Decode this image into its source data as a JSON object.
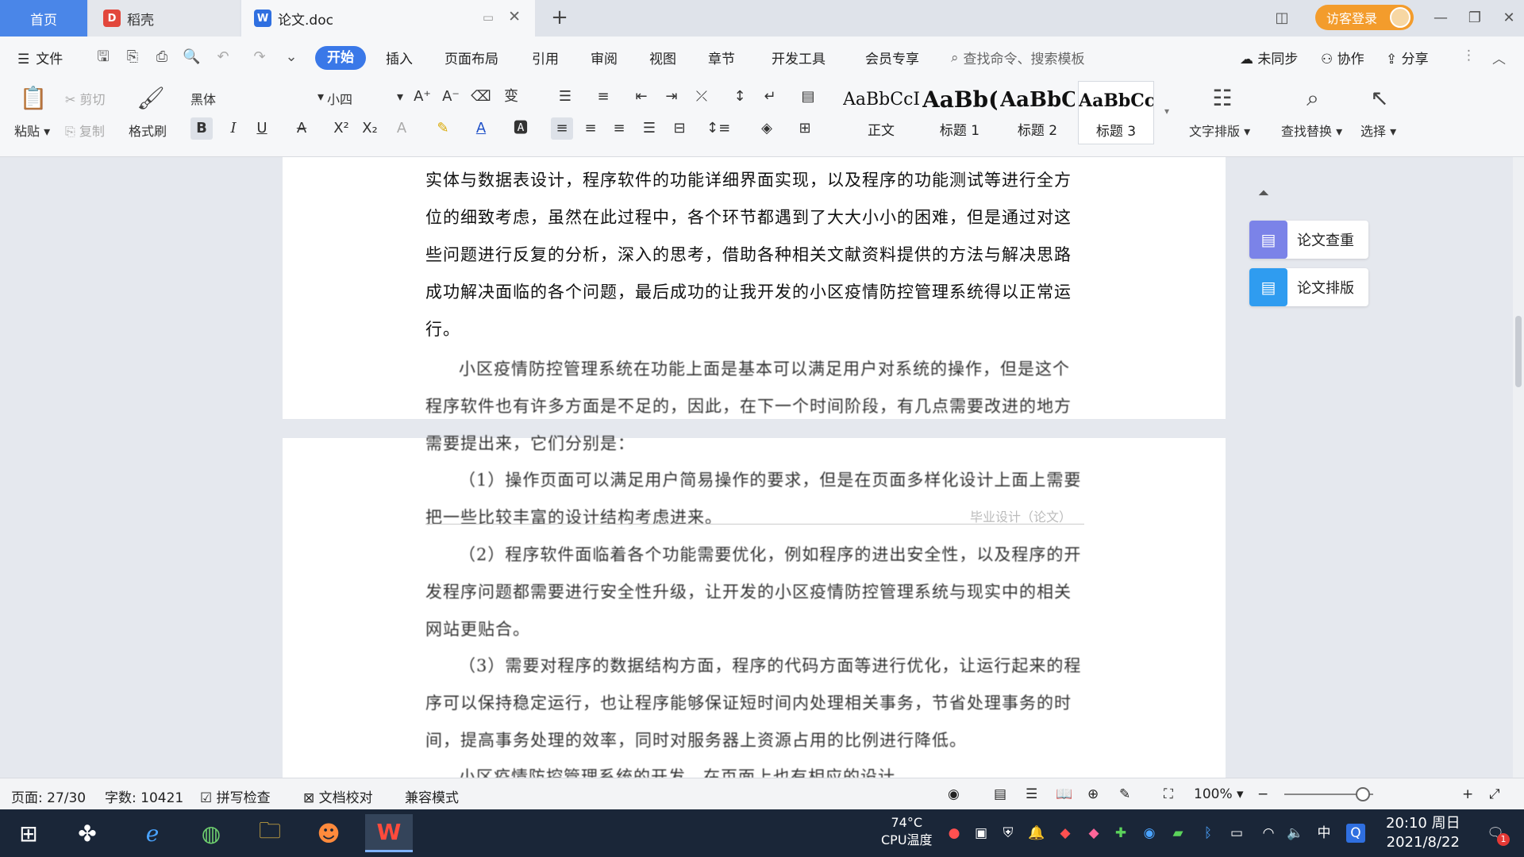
{
  "tabs": {
    "home": "首页",
    "daoke": "稻壳",
    "doc": "论文.doc",
    "visitor_login": "访客登录"
  },
  "menu": {
    "file": "文件",
    "start": "开始",
    "insert": "插入",
    "layout": "页面布局",
    "reference": "引用",
    "review": "审阅",
    "view": "视图",
    "chapter": "章节",
    "devtools": "开发工具",
    "member": "会员专享",
    "search": "查找命令、搜索模板",
    "unsync": "未同步",
    "collab": "协作",
    "share": "分享"
  },
  "ribbon": {
    "paste": "粘贴",
    "cut": "剪切",
    "copy": "复制",
    "format_painter": "格式刷",
    "font_name": "黑体",
    "font_size": "小四",
    "styles": [
      {
        "sample": "AaBbCcI",
        "name": "正文"
      },
      {
        "sample": "AaBb(",
        "name": "标题 1"
      },
      {
        "sample": "AaBbC",
        "name": "标题 2"
      },
      {
        "sample": "AaBbCcl",
        "name": "标题 3"
      }
    ],
    "text_layout": "文字排版",
    "find_replace": "查找替换",
    "select": "选择"
  },
  "document": {
    "para1": "实体与数据表设计，程序软件的功能详细界面实现，以及程序的功能测试等进行全方位的细致考虑，虽然在此过程中，各个环节都遇到了大大小小的困难，但是通过对这些问题进行反复的分析，深入的思考，借助各种相关文献资料提供的方法与解决思路成功解决面临的各个问题，最后成功的让我开发的小区疫情防控管理系统得以正常运行。",
    "para2": "小区疫情防控管理系统在功能上面是基本可以满足用户对系统的操作，但是这个程序软件也有许多方面是不足的，因此，在下一个时间阶段，有几点需要改进的地方需要提出来，它们分别是：",
    "para3": "（1）操作页面可以满足用户简易操作的要求，但是在页面多样化设计上面上需要把一些比较丰富的设计结构考虑进来。",
    "para4": "（2）程序软件面临着各个功能需要优化，例如程序的进出安全性，以及程序的开发程序问题都需要进行安全性升级，让开发的小区疫情防控管理系统与现实中的相关网站更贴合。",
    "para5": "（3）需要对程序的数据结构方面，程序的代码方面等进行优化，让运行起来的程序可以保持稳定运行，也让程序能够保证短时间内处理相关事务，节省处理事务的时间，提高事务处理的效率，同时对服务器上资源占用的比例进行降低。",
    "para6": "小区疫情防控管理系统的开发，在页面上也有相应的设计...",
    "footer": "毕业设计（论文）"
  },
  "side_panel": {
    "check": "论文查重",
    "layout": "论文排版"
  },
  "status": {
    "page": "页面: 27/30",
    "words": "字数: 10421",
    "spell": "拼写检查",
    "proof": "文档校对",
    "compat": "兼容模式",
    "zoom": "100%"
  },
  "taskbar": {
    "cpu_temp": "74°C",
    "cpu_label": "CPU温度",
    "ime": "中",
    "time": "20:10 周日",
    "date": "2021/8/22",
    "notify_count": "1"
  },
  "colors": {
    "accent": "#3a78e8",
    "visitor": "#f39c2c",
    "taskbar": "#1a2638",
    "side_check": "#7b83e8",
    "side_layout": "#2f9cf0"
  }
}
